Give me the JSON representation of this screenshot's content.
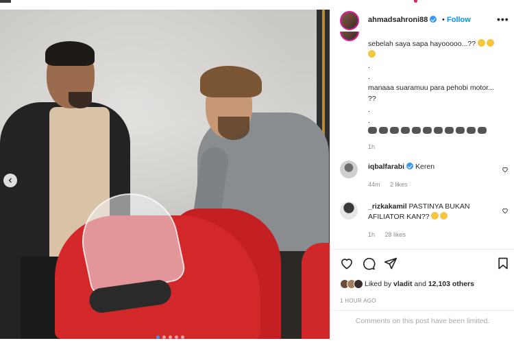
{
  "post": {
    "username": "ahmadsahroni88",
    "dot": "•",
    "follow_label": "Follow",
    "more_label": "•••",
    "carousel": {
      "slide_count": 5,
      "active_index": 0
    }
  },
  "caption": {
    "line1": "sebelah saya sapa hayooooo...??",
    "sep1": ".",
    "sep2": ".",
    "line2": "manaaa suaramuu para pehobi motor...",
    "line3": "??",
    "sep3": ".",
    "sep4": ".",
    "meta": "1h"
  },
  "comments": [
    {
      "username": "iqbalfarabi",
      "text": "Keren",
      "time": "44m",
      "likes": "2 likes"
    },
    {
      "username": "_rizkakamil",
      "text": "PASTINYA BUKAN AFILIATOR KAN??",
      "time": "1h",
      "likes": "28 likes"
    }
  ],
  "likes": {
    "prefix": "Liked by ",
    "user": "vladit",
    "middle": " and ",
    "count": "12,103 others"
  },
  "timestamp": "1 HOUR AGO",
  "comments_disabled": "Comments on this post have been limited.",
  "colors": {
    "accent": "#0095f6",
    "verified": "#3897f0",
    "muted": "#8e8e8e"
  }
}
